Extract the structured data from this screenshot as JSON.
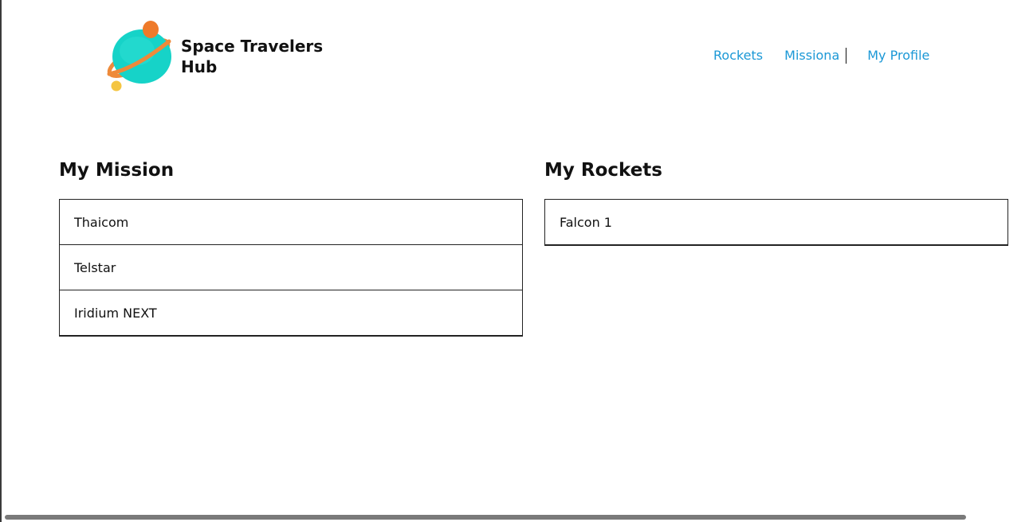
{
  "brand": {
    "line1": "Space Travelers",
    "line2": "Hub"
  },
  "nav": {
    "rockets": "Rockets",
    "missions": "Missiona",
    "profile": "My Profile"
  },
  "missions": {
    "heading": "My Mission",
    "items": [
      "Thaicom",
      "Telstar",
      "Iridium NEXT"
    ]
  },
  "rockets": {
    "heading": "My Rockets",
    "items": [
      "Falcon 1"
    ]
  },
  "colors": {
    "link": "#1b98d6",
    "planet": "#16d3c8",
    "ring": "#ee8a3a",
    "moon": "#f4c542"
  }
}
